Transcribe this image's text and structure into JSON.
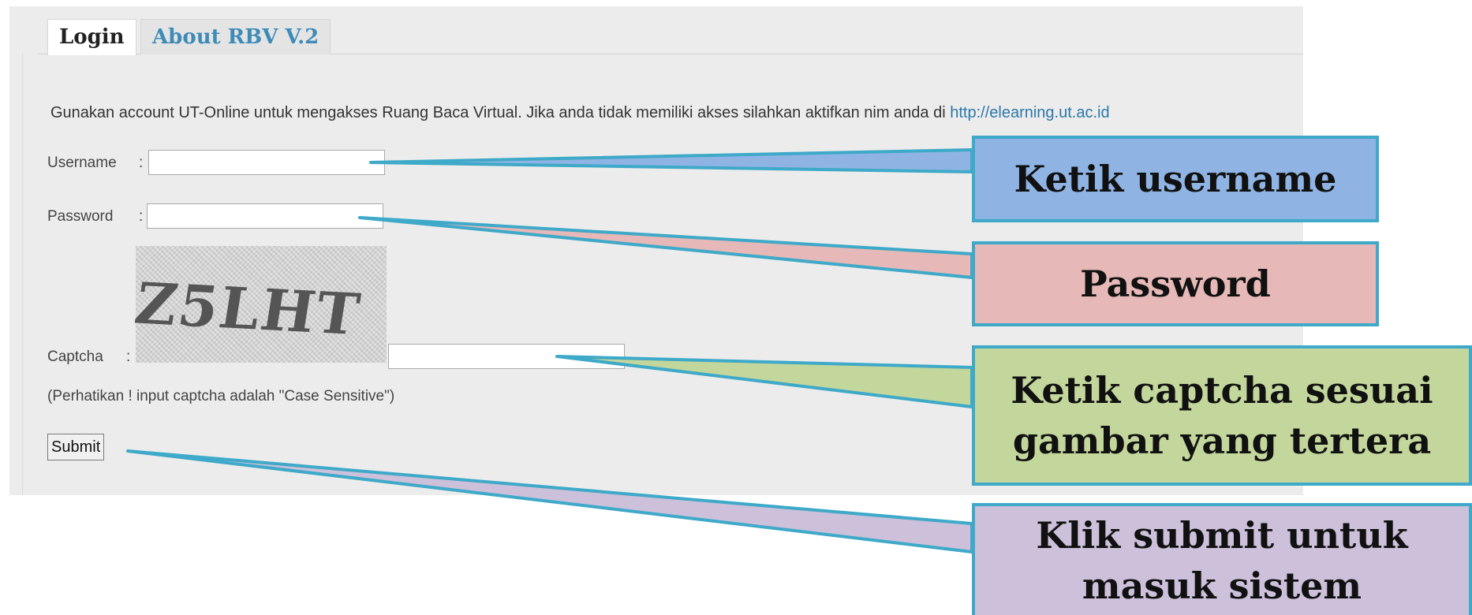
{
  "tabs": {
    "login": "Login",
    "about": "About RBV V.2"
  },
  "form": {
    "info_text": "Gunakan account UT-Online untuk mengakses Ruang Baca Virtual. Jika anda tidak memiliki akses silahkan aktifkan nim anda di ",
    "info_link": "http://elearning.ut.ac.id",
    "username_label": "Username",
    "password_label": "Password",
    "captcha_label": "Captcha",
    "colon": ":",
    "username_value": "",
    "password_value": "",
    "captcha_value": "",
    "captcha_image_text": "Z5LHT",
    "note": "(Perhatikan ! input captcha adalah \"Case Sensitive\")",
    "submit_label": "Submit"
  },
  "callouts": {
    "username": "Ketik username",
    "password": "Password",
    "captcha": "Ketik captcha sesuai gambar yang tertera",
    "submit": "Klik submit untuk masuk sistem"
  },
  "colors": {
    "link": "#2b78a8",
    "callout_border": "#3ea9c8",
    "callout_username": "#8fb4e3",
    "callout_password": "#e6b8b7",
    "callout_captcha": "#c3d69b",
    "callout_submit": "#ccc0da"
  }
}
